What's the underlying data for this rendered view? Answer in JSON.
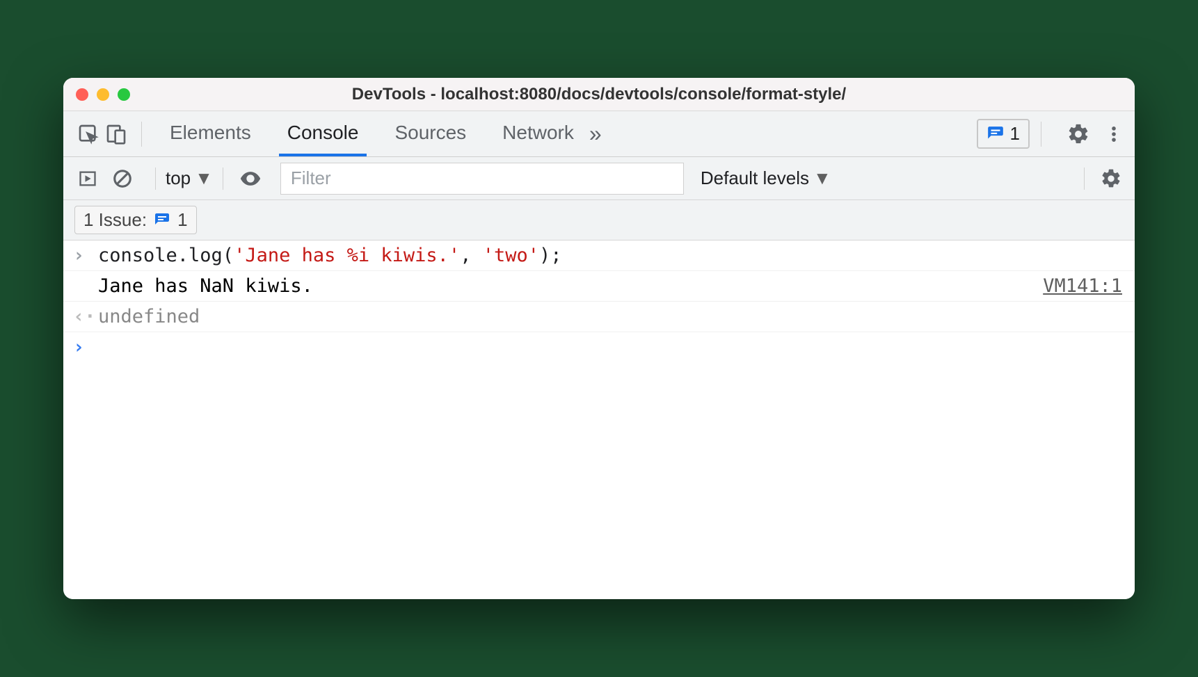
{
  "window": {
    "title": "DevTools - localhost:8080/docs/devtools/console/format-style/"
  },
  "tabs": {
    "items": [
      "Elements",
      "Console",
      "Sources",
      "Network"
    ],
    "active_index": 1,
    "overflow_glyph": "»"
  },
  "issues_badge": {
    "count": "1"
  },
  "toolbar": {
    "context": "top",
    "filter_placeholder": "Filter",
    "levels_label": "Default levels"
  },
  "issues_chip": {
    "prefix": "1 Issue:",
    "count": "1"
  },
  "console": {
    "input_gutter": ">",
    "output_gutter": "",
    "return_gutter": "<·",
    "prompt_gutter": ">",
    "lines": [
      {
        "type": "input",
        "code_prefix": "console.log(",
        "code_str1": "'Jane has %i kiwis.'",
        "code_mid": ", ",
        "code_str2": "'two'",
        "code_suffix": ");"
      },
      {
        "type": "output",
        "text": "Jane has NaN kiwis.",
        "source": "VM141:1"
      },
      {
        "type": "return",
        "text": "undefined"
      }
    ]
  }
}
